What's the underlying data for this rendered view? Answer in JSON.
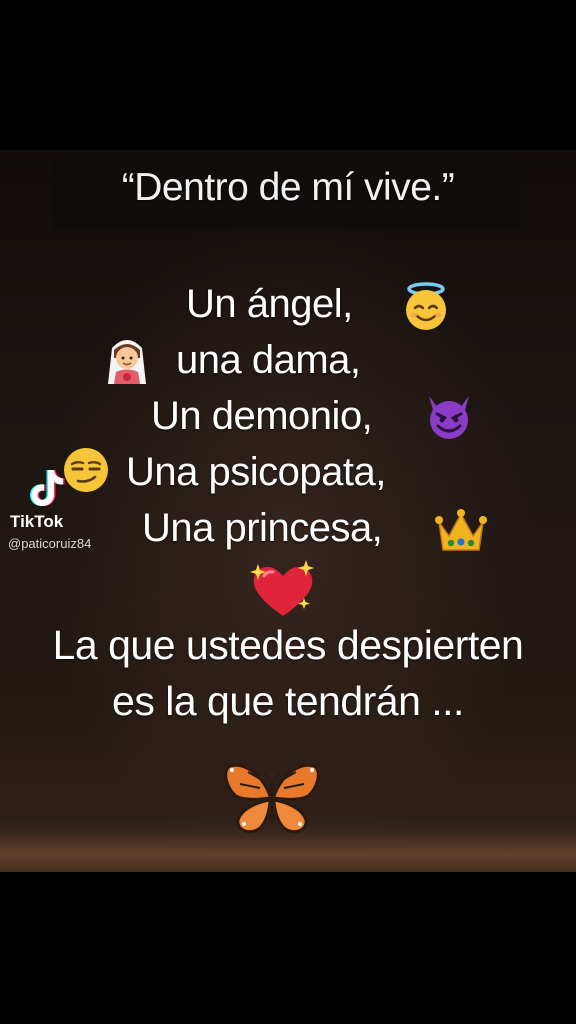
{
  "quote": "“Dentro de mí vive.”",
  "lines": [
    "Un ángel,",
    "una dama,",
    "Un demonio,",
    "Una psicopata,",
    "Una princesa,"
  ],
  "closing": [
    "La que ustedes despierten",
    "es la que tendrán ..."
  ],
  "watermark": {
    "brand": "TikTok",
    "handle": "@paticoruiz84"
  },
  "emojis": {
    "angel": "angel-face-icon",
    "lady": "bride-icon",
    "demon": "devil-face-icon",
    "psycho": "smirk-face-icon",
    "princess": "crown-icon",
    "heart": "sparkling-heart-icon",
    "butterfly": "butterfly-icon"
  }
}
